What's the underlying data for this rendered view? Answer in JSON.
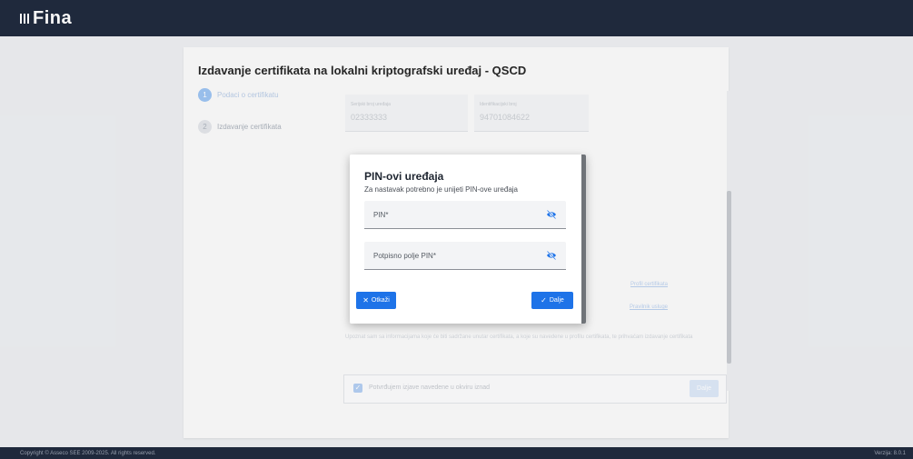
{
  "app": {
    "logo_text": "Fina"
  },
  "page": {
    "title": "Izdavanje certifikata na lokalni kriptografski uređaj - QSCD"
  },
  "stepper": {
    "steps": [
      {
        "number": "1",
        "label": "Podaci o certifikatu"
      },
      {
        "number": "2",
        "label": "Izdavanje certifikata"
      }
    ]
  },
  "background_form": {
    "fields": [
      {
        "label": "Serijski broj uređaja",
        "value": "02333333"
      },
      {
        "label": "Identifikacijski broj",
        "value": "94701084622"
      }
    ],
    "link_text": "Profil certifikata",
    "link2_text": "Pravilnik usluge",
    "note": "Upoznat sam sa informacijama koje će biti sadržane unutar certifikata, a koje su navedene u profilu certifikata, te prihvaćam izdavanje certifikata",
    "confirm_text": "Potvrđujem izjave navedene u okviru iznad",
    "confirm_button": "Dalje"
  },
  "modal": {
    "title": "PIN-ovi uređaja",
    "subtitle": "Za nastavak potrebno je unijeti PIN-ove uređaja",
    "pin_label": "PIN*",
    "signature_pin_label": "Potpisno polje PIN*",
    "cancel_label": "Otkaži",
    "next_label": "Dalje"
  },
  "footer": {
    "copyright": "Copyright © Asseco SEE 2009-2025. All rights reserved.",
    "version": "Verzija: 8.0.1"
  },
  "colors": {
    "primary": "#1e73e8",
    "topbar": "#1b2539"
  }
}
